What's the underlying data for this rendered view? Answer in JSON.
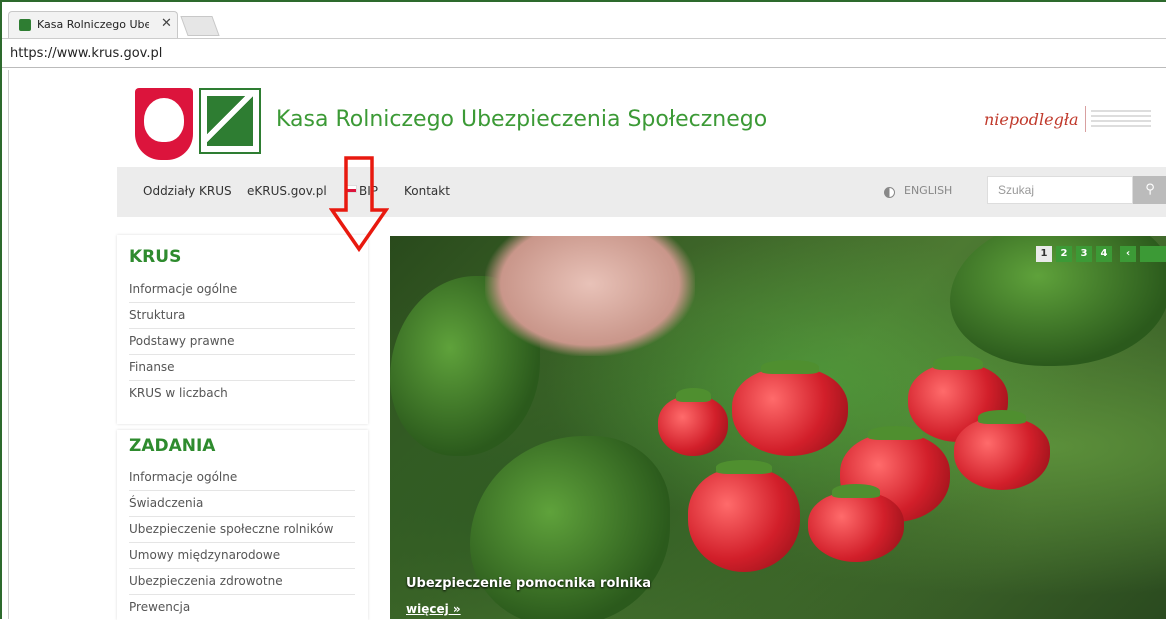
{
  "browser": {
    "tab_title": "Kasa Rolniczego Ubezpie",
    "tab_close": "✕",
    "address": "https://www.krus.gov.pl"
  },
  "header": {
    "site_title": "Kasa Rolniczego Ubezpieczenia Społecznego",
    "niepodlegla": "niepodległa"
  },
  "nav": {
    "items": [
      "Oddziały KRUS",
      "eKRUS.gov.pl",
      "BIP",
      "Kontakt"
    ],
    "english": "ENGLISH",
    "search_placeholder": "Szukaj",
    "search_icon": "⚲"
  },
  "sidebar": {
    "krus_heading": "KRUS",
    "krus_items": [
      "Informacje ogólne",
      "Struktura",
      "Podstawy prawne",
      "Finanse",
      "KRUS w liczbach"
    ],
    "zadania_heading": "ZADANIA",
    "zadania_items": [
      "Informacje ogólne",
      "Świadczenia",
      "Ubezpieczenie społeczne rolników",
      "Umowy międzynarodowe",
      "Ubezpieczenia zdrowotne",
      "Prewencja"
    ]
  },
  "hero": {
    "pager": [
      "1",
      "2",
      "3",
      "4",
      "‹"
    ],
    "caption": "Ubezpieczenie pomocnika rolnika",
    "more": "więcej »"
  },
  "colors": {
    "brand_green": "#3c9a36",
    "annotation_red": "#e8190f"
  }
}
